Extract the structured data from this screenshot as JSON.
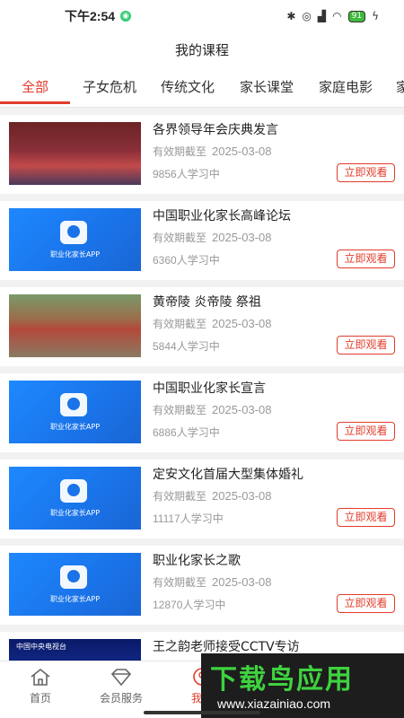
{
  "status_bar": {
    "time": "下午2:54",
    "battery": "91"
  },
  "header": {
    "title": "我的课程"
  },
  "tabs": [
    "全部",
    "子女危机",
    "传统文化",
    "家长课堂",
    "家庭电影",
    "家"
  ],
  "courses": [
    {
      "title": "各界领导年会庆典发言",
      "expiry_label": "有效期截至",
      "expiry_date": "2025-03-08",
      "learners": "9856人学习中",
      "button": "立即观看",
      "thumb": "photo1",
      "thumb_text": ""
    },
    {
      "title": "中国职业化家长高峰论坛",
      "expiry_label": "有效期截至",
      "expiry_date": "2025-03-08",
      "learners": "6360人学习中",
      "button": "立即观看",
      "thumb": "blue",
      "thumb_text": "职业化家长APP"
    },
    {
      "title": "黄帝陵 炎帝陵 祭祖",
      "expiry_label": "有效期截至",
      "expiry_date": "2025-03-08",
      "learners": "5844人学习中",
      "button": "立即观看",
      "thumb": "photo2",
      "thumb_text": ""
    },
    {
      "title": "中国职业化家长宣言",
      "expiry_label": "有效期截至",
      "expiry_date": "2025-03-08",
      "learners": "6886人学习中",
      "button": "立即观看",
      "thumb": "blue",
      "thumb_text": "职业化家长APP"
    },
    {
      "title": "定安文化首届大型集体婚礼",
      "expiry_label": "有效期截至",
      "expiry_date": "2025-03-08",
      "learners": "11117人学习中",
      "button": "立即观看",
      "thumb": "blue",
      "thumb_text": "职业化家长APP"
    },
    {
      "title": "职业化家长之歌",
      "expiry_label": "有效期截至",
      "expiry_date": "2025-03-08",
      "learners": "12870人学习中",
      "button": "立即观看",
      "thumb": "blue",
      "thumb_text": "职业化家长APP"
    },
    {
      "title": "王之韵老师接受CCTV专访",
      "expiry_label": "",
      "expiry_date": "",
      "learners": "",
      "button": "",
      "thumb": "photo3",
      "thumb_text": "中国中央电视台"
    }
  ],
  "bottom_nav": [
    {
      "label": "首页",
      "icon": "home-icon"
    },
    {
      "label": "会员服务",
      "icon": "diamond-icon"
    },
    {
      "label": "我的",
      "icon": "user-icon"
    }
  ],
  "watermark": {
    "big": "下载鸟应用",
    "small": "www.xiazainiao.com"
  },
  "colors": {
    "accent": "#e23c2b",
    "thumb_blue": "#1a73e8"
  }
}
